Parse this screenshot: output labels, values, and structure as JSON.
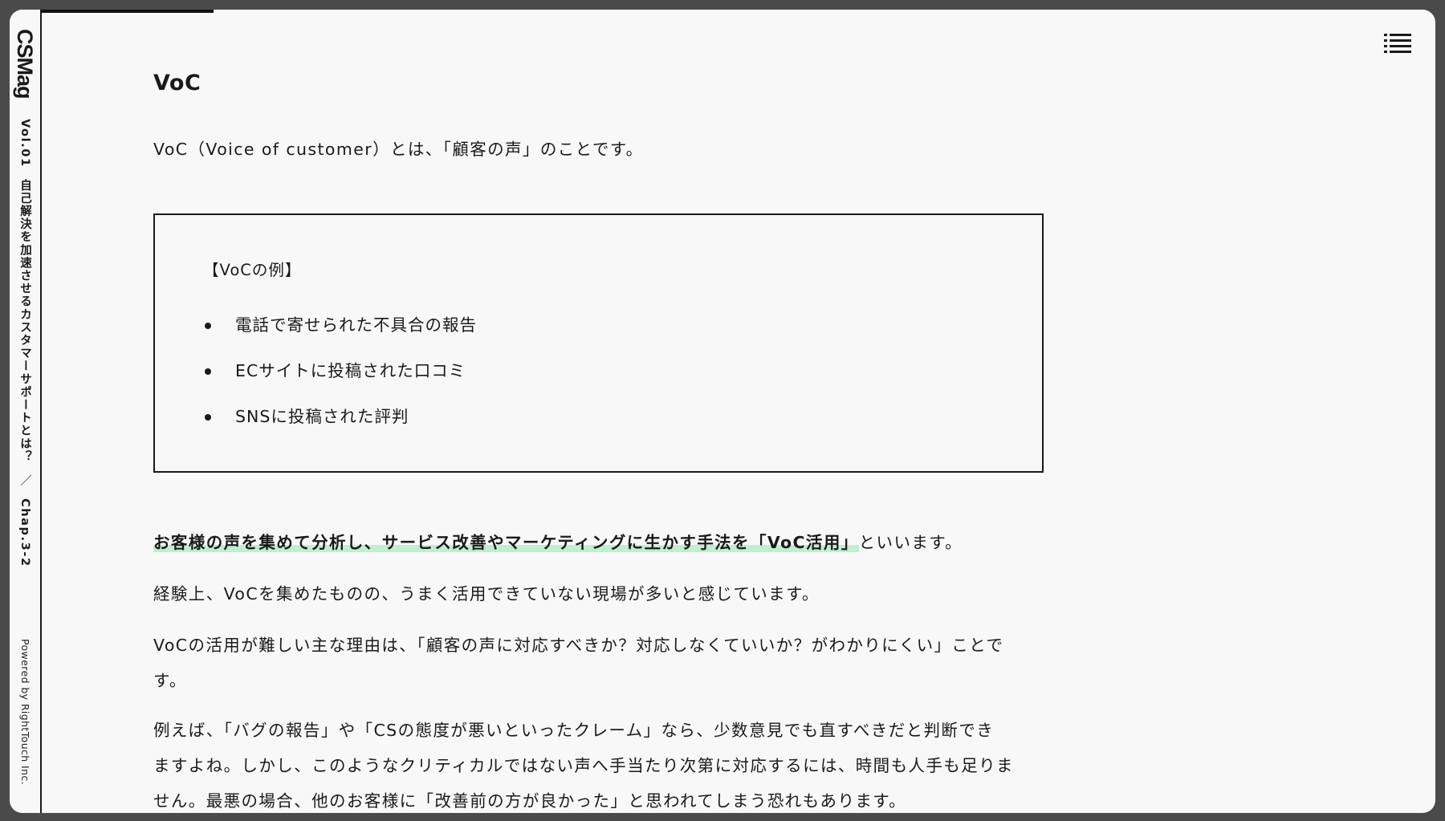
{
  "sidebar": {
    "logo": "CSMag",
    "volume": "Vol.01",
    "issue_title": "自己解決を加速させるカスタマーサポートとは？",
    "separator": "／",
    "chapter": "Chap.3-2",
    "powered_by": "Powered by RightTouch Inc."
  },
  "progress": 0.13,
  "menu_icon": "hamburger-icon",
  "article": {
    "heading": "VoC",
    "intro": "VoC（Voice of customer）とは、「顧客の声」のことです。",
    "example_box": {
      "title": "【VoCの例】",
      "items": [
        {
          "text": "電話で寄せられた不具合の報告"
        },
        {
          "text": "ECサイトに投稿された口コミ"
        },
        {
          "text": "SNSに投稿された評判"
        }
      ]
    },
    "highlight_text": "お客様の声を集めて分析し、サービス改善やマーケティングに生かす手法を「VoC活用」",
    "highlight_suffix": "といいます。",
    "paragraph_2": "経験上、VoCを集めたものの、うまく活用できていない現場が多いと感じています。",
    "paragraph_3_line1": "VoCの活用が難しい主な理由は、「顧客の声に対応すべきか？対応しなくていいか？がわかりにくい」ことで",
    "paragraph_3_line2": "す。",
    "paragraph_4_line1": "例えば、「バグの報告」や「CSの態度が悪いといったクレーム」なら、少数意見でも直すべきだと判断でき",
    "paragraph_4_line2": "ますよね。しかし、このようなクリティカルではない声へ手当たり次第に対応するには、時間も人手も足りま",
    "paragraph_4_line3": "せん。最悪の場合、他のお客様に「改善前の方が良かった」と思われてしまう恐れもあります。"
  }
}
